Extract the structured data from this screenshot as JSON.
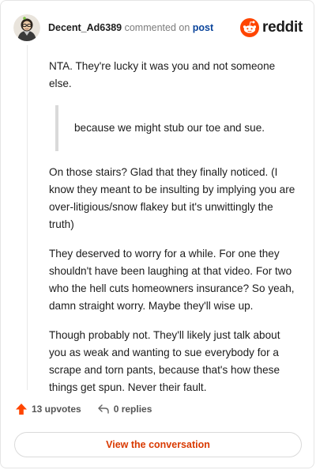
{
  "header": {
    "username": "Decent_Ad6389",
    "commented_on": "commented on",
    "post_link": "post",
    "brand": "reddit"
  },
  "comment": {
    "intro": "NTA. They're lucky it was you and not someone else.",
    "quote": "because we might stub our toe and sue.",
    "paragraphs": [
      "On those stairs? Glad that they finally noticed. (I know they meant to be insulting by implying you are over-litigious/snow flakey but it's unwittingly the truth)",
      "They deserved to worry for a while. For one they shouldn't have been laughing at that video. For two who the hell cuts homeowners insurance? So yeah, damn straight worry. Maybe they'll wise up.",
      "Though probably not. They'll likely just talk about you as weak and wanting to sue everybody for a scrape and torn pants, because that's how these things get spun. Never their fault."
    ]
  },
  "actions": {
    "upvotes": "13 upvotes",
    "replies": "0 replies",
    "view_conversation": "View the conversation"
  },
  "colors": {
    "brand_orange": "#ff4500",
    "upvote_orange": "#ff4500",
    "link_blue": "#0a449b",
    "cta_text": "#d93900"
  },
  "icons": {
    "avatar": "user-avatar",
    "brand": "reddit-snoo-icon",
    "upvote": "upvote-arrow-icon",
    "reply": "reply-arrow-icon"
  }
}
